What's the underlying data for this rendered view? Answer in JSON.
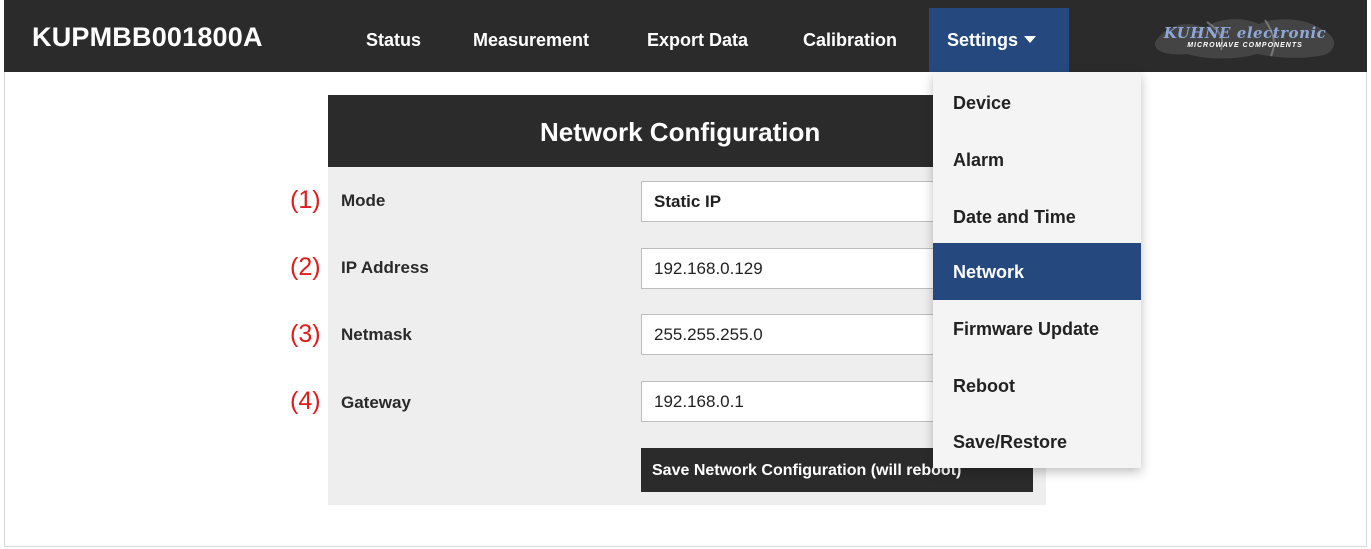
{
  "navbar": {
    "brand": "KUPMBB001800A",
    "items": [
      {
        "label": "Status"
      },
      {
        "label": "Measurement"
      },
      {
        "label": "Export Data"
      },
      {
        "label": "Calibration"
      }
    ],
    "settings_label": "Settings",
    "logo": {
      "text": "KUHNE electronic",
      "subtext": "MICROWAVE COMPONENTS"
    },
    "colors": {
      "bar": "#2b2b2b",
      "active": "#25497f"
    }
  },
  "settings_menu": {
    "items": [
      {
        "label": "Device"
      },
      {
        "label": "Alarm"
      },
      {
        "label": "Date and Time"
      },
      {
        "label": "Network"
      },
      {
        "label": "Firmware Update"
      },
      {
        "label": "Reboot"
      },
      {
        "label": "Save/Restore"
      }
    ],
    "active": "Network"
  },
  "panel": {
    "title": "Network Configuration",
    "fields": [
      {
        "number": "(1)",
        "label": "Mode",
        "value": "Static IP"
      },
      {
        "number": "(2)",
        "label": "IP Address",
        "value": "192.168.0.129"
      },
      {
        "number": "(3)",
        "label": "Netmask",
        "value": "255.255.255.0"
      },
      {
        "number": "(4)",
        "label": "Gateway",
        "value": "192.168.0.1"
      }
    ],
    "save_label": "Save Network Configuration (will reboot)",
    "annotation_color": "#e01b1b"
  }
}
